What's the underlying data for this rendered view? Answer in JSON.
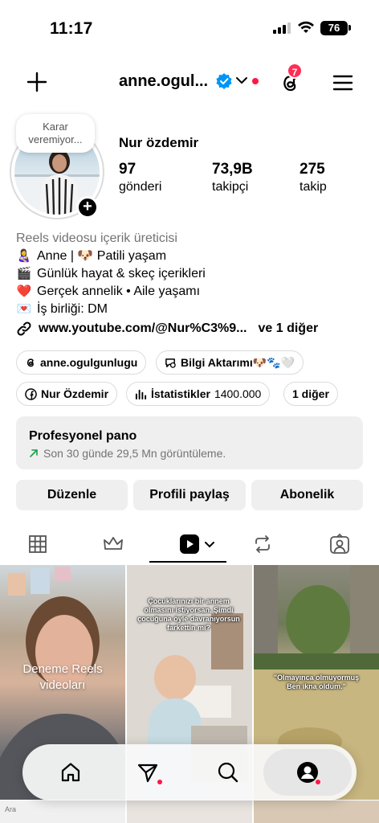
{
  "status_bar": {
    "time": "11:17",
    "battery": "76"
  },
  "header": {
    "username": "anne.ogul...",
    "notification_count": "7"
  },
  "profile": {
    "note": "Karar veremiyor...",
    "display_name": "Nur özdemir",
    "stats": [
      {
        "value": "97",
        "label": "gönderi"
      },
      {
        "value": "73,9B",
        "label": "takipçi"
      },
      {
        "value": "275",
        "label": "takip"
      }
    ],
    "category": "Reels videosu içerik üreticisi",
    "bio_lines": [
      {
        "icon": "👩‍🍼",
        "text": "Anne | 🐶 Patili yaşam"
      },
      {
        "icon": "🎬",
        "text": "Günlük hayat & skeç içerikleri"
      },
      {
        "icon": "❤️",
        "text": "Gerçek annelik • Aile yaşamı"
      },
      {
        "icon": "💌",
        "text": "İş birliği: DM"
      }
    ],
    "link": {
      "url": "www.youtube.com/@Nur%C3%9...",
      "more": "ve 1 diğer"
    }
  },
  "chips": {
    "threads": "anne.ogulgunlugu",
    "broadcast": "Bilgi Aktarımı🐶🐾🤍",
    "facebook": "Nur Özdemir",
    "insights_label": "İstatistikler",
    "insights_value": "1400.000",
    "more": "1 diğer"
  },
  "pro_dashboard": {
    "title": "Profesyonel pano",
    "subtitle": "Son 30 günde 29,5 Mn görüntüleme."
  },
  "actions": {
    "edit": "Düzenle",
    "share": "Profili paylaş",
    "subscription": "Abonelik"
  },
  "grid": {
    "cell1_caption": "Deneme Reels videoları",
    "cell2_overlay": "Çocuklarınızı bir annem olmasını istiyorsan. Şimdi çocuğuna öyle davranıyorsun farkettin mi?",
    "cell3_overlay": "\"Olmayınca olmuyormuş Ben ikna oldum.\"",
    "row2_search": "Ara"
  },
  "colors": {
    "accent_blue": "#0095f6",
    "badge_red": "#ff2d55",
    "chip_border": "#dbdbdb",
    "button_bg": "#efefef"
  },
  "icons": {
    "top_bar": [
      "plus-icon",
      "verified-icon",
      "chevron-down-icon",
      "threads-icon",
      "menu-icon"
    ],
    "tabs": [
      "grid-icon",
      "crown-icon",
      "reels-icon",
      "repost-icon",
      "tagged-icon"
    ],
    "bottom_nav": [
      "home-icon",
      "send-icon",
      "search-icon",
      "profile-icon"
    ]
  }
}
